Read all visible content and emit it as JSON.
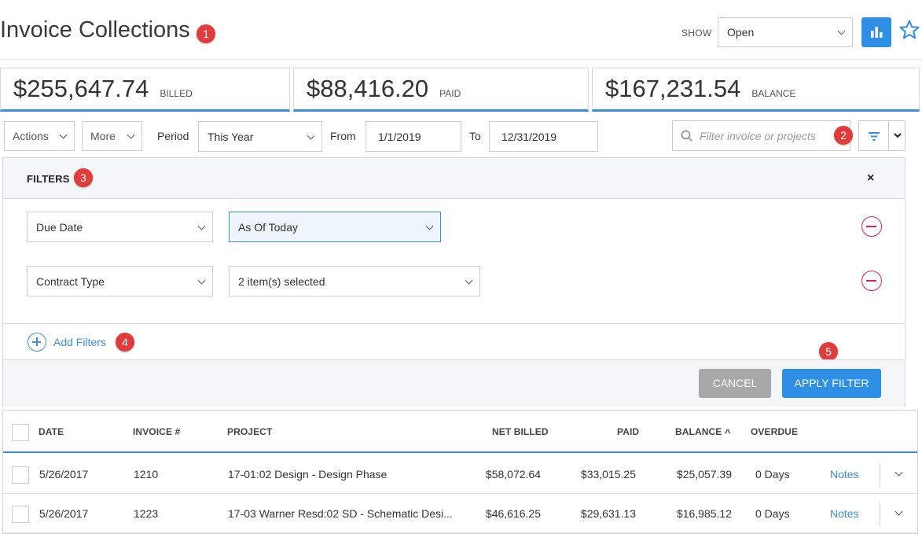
{
  "header": {
    "title": "Invoice Collections",
    "show_label": "SHOW",
    "show_value": "Open",
    "badges": [
      "1",
      "2",
      "3",
      "4",
      "5"
    ]
  },
  "totals": [
    {
      "amount": "$255,647.74",
      "label": "BILLED"
    },
    {
      "amount": "$88,416.20",
      "label": "PAID"
    },
    {
      "amount": "$167,231.54",
      "label": "BALANCE"
    }
  ],
  "toolbar": {
    "actions_label": "Actions",
    "more_label": "More",
    "period_label": "Period",
    "period_value": "This Year",
    "from_label": "From",
    "from_value": "1/1/2019",
    "to_label": "To",
    "to_value": "12/31/2019",
    "search_placeholder": "Filter invoice or projects"
  },
  "filters": {
    "title": "FILTERS",
    "close": "×",
    "rows": [
      {
        "field": "Due Date",
        "value": "As Of Today"
      },
      {
        "field": "Contract Type",
        "value": "2 item(s) selected"
      }
    ],
    "add_label": "Add Filters",
    "cancel_label": "CANCEL",
    "apply_label": "APPLY FILTER"
  },
  "table": {
    "columns": [
      "DATE",
      "INVOICE #",
      "PROJECT",
      "NET BILLED",
      "PAID",
      "BALANCE",
      "OVERDUE"
    ],
    "sort_indicator": "^",
    "rows": [
      {
        "date": "5/26/2017",
        "invoice": "1210",
        "project": "17-01:02 Design - Design Phase",
        "net_billed": "$58,072.64",
        "paid": "$33,015.25",
        "balance": "$25,057.39",
        "overdue": "0 Days",
        "notes": "Notes"
      },
      {
        "date": "5/26/2017",
        "invoice": "1223",
        "project": "17-03 Warner Resd:02 SD - Schematic Desi...",
        "net_billed": "$46,616.25",
        "paid": "$29,631.13",
        "balance": "$16,985.12",
        "overdue": "0 Days",
        "notes": "Notes"
      }
    ]
  },
  "colors": {
    "accent": "#2e8fe5",
    "badge": "#e03c3c",
    "remove": "#d4245a"
  }
}
